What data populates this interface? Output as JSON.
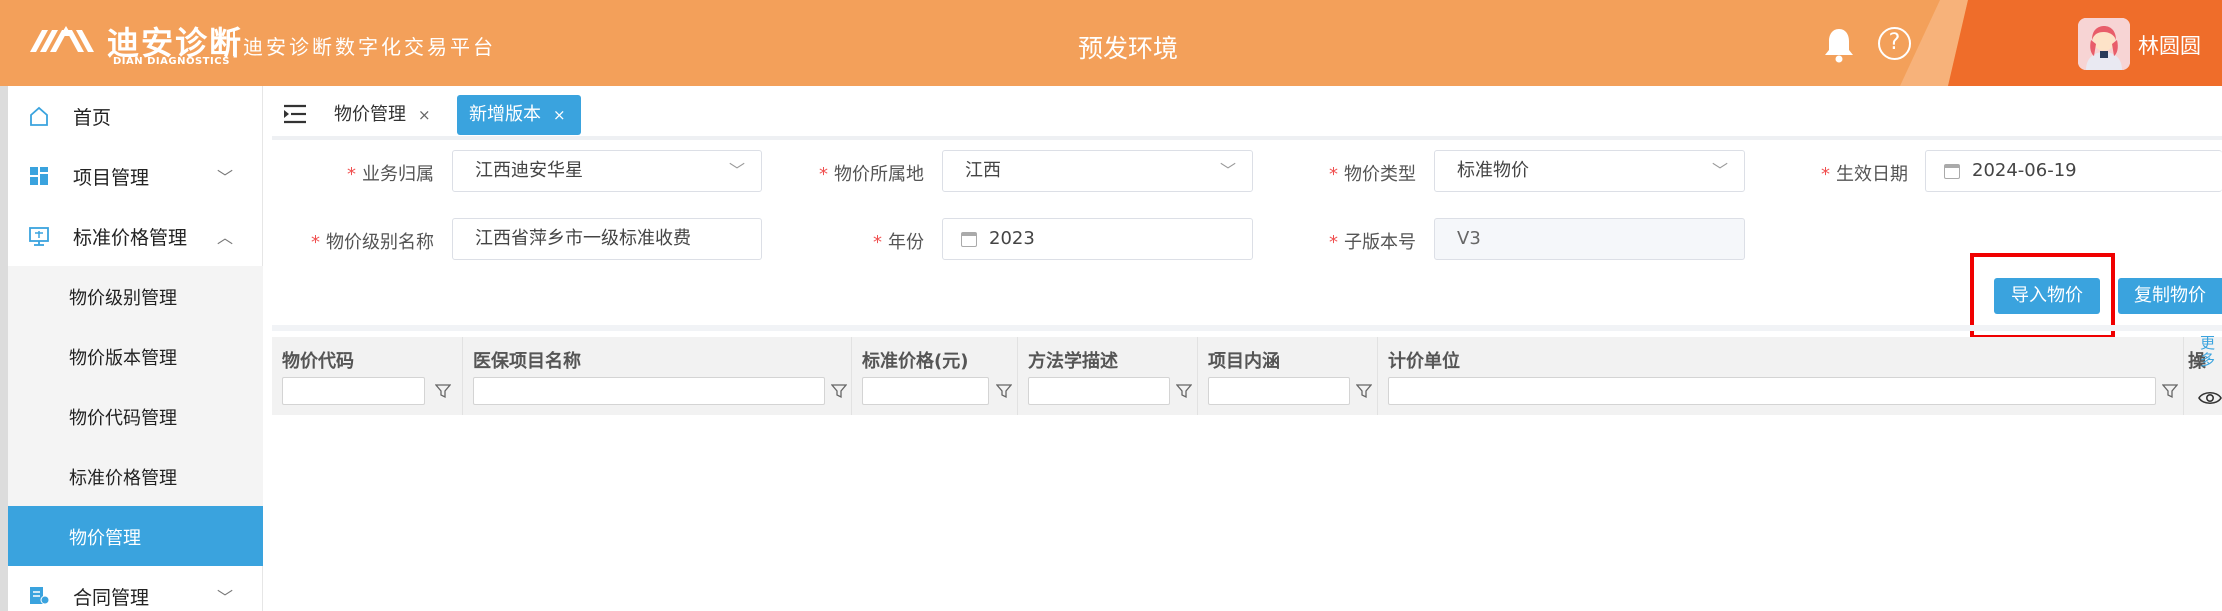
{
  "header": {
    "logo_cn": "迪安诊断",
    "logo_en": "DIAN DIAGNOSTICS",
    "platform": "迪安诊断数字化交易平台",
    "environment": "预发环境",
    "help_glyph": "?",
    "user_name": "林圆圆",
    "colors": {
      "bar": "#F3A05A",
      "accent": "#EF6D2A"
    }
  },
  "sidebar": {
    "items": [
      {
        "label": "首页",
        "icon": "home-icon"
      },
      {
        "label": "项目管理",
        "icon": "grid-icon",
        "chevron": "﹀"
      },
      {
        "label": "标准价格管理",
        "icon": "monitor-icon",
        "chevron": "︿"
      }
    ],
    "sub_items": [
      {
        "label": "物价级别管理"
      },
      {
        "label": "物价版本管理"
      },
      {
        "label": "物价代码管理"
      },
      {
        "label": "标准价格管理"
      },
      {
        "label": "物价管理",
        "active": true
      }
    ],
    "bottom_item": {
      "label": "合同管理",
      "icon": "contract-icon",
      "chevron": "﹀"
    },
    "active_color": "#3AA3DE"
  },
  "tabs": [
    {
      "label": "物价管理",
      "close": "×"
    },
    {
      "label": "新增版本",
      "close": "×",
      "active": true
    }
  ],
  "form": {
    "required_mark": "*",
    "business_owner": {
      "label": "业务归属",
      "value": "江西迪安华星"
    },
    "price_region": {
      "label": "物价所属地",
      "value": "江西"
    },
    "price_type": {
      "label": "物价类型",
      "value": "标准物价"
    },
    "effective_date": {
      "label": "生效日期",
      "value": "2024-06-19"
    },
    "level_name": {
      "label": "物价级别名称",
      "value": "江西省萍乡市一级标准收费"
    },
    "year": {
      "label": "年份",
      "value": "2023"
    },
    "sub_version": {
      "label": "子版本号",
      "value": "V3"
    }
  },
  "actions": {
    "import_label": "导入物价",
    "copy_label": "复制物价"
  },
  "table": {
    "columns": [
      {
        "title": "物价代码"
      },
      {
        "title": "医保项目名称"
      },
      {
        "title": "标准价格(元)"
      },
      {
        "title": "方法学描述"
      },
      {
        "title": "项目内涵"
      },
      {
        "title": "计价单位"
      }
    ],
    "more_label": "更多",
    "partial_header": "操"
  }
}
